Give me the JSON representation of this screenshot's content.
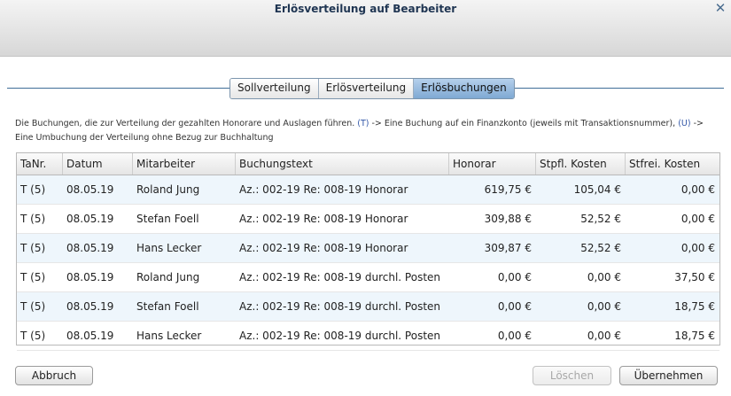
{
  "window": {
    "title": "Erlösverteilung auf Bearbeiter"
  },
  "tabs": [
    {
      "label": "Sollverteilung"
    },
    {
      "label": "Erlösverteilung"
    },
    {
      "label": "Erlösbuchungen"
    }
  ],
  "active_tab": "Erlösbuchungen",
  "description": {
    "part1": "Die Buchungen, die zur Verteilung der gezahlten Honorare und Auslagen führen. ",
    "mark1": "(T)",
    "part2": " -> Eine Buchung auf ein Finanzkonto (jeweils mit Transaktionsnummer), ",
    "mark2": "(U)",
    "part3": " -> Eine Umbuchung der Verteilung ohne Bezug zur Buchhaltung"
  },
  "table": {
    "columns": [
      "TaNr.",
      "Datum",
      "Mitarbeiter",
      "Buchungstext",
      "Honorar",
      "Stpfl. Kosten",
      "Stfrei. Kosten"
    ],
    "rows": [
      [
        "T (5)",
        "08.05.19",
        "Roland Jung",
        "Az.: 002-19 Re: 008-19  Honorar",
        "619,75 €",
        "105,04 €",
        "0,00 €"
      ],
      [
        "T (5)",
        "08.05.19",
        "Stefan Foell",
        "Az.: 002-19 Re: 008-19  Honorar",
        "309,88 €",
        "52,52 €",
        "0,00 €"
      ],
      [
        "T (5)",
        "08.05.19",
        "Hans Lecker",
        "Az.: 002-19 Re: 008-19  Honorar",
        "309,87 €",
        "52,52 €",
        "0,00 €"
      ],
      [
        "T (5)",
        "08.05.19",
        "Roland Jung",
        "Az.: 002-19 Re: 008-19  durchl. Posten",
        "0,00 €",
        "0,00 €",
        "37,50 €"
      ],
      [
        "T (5)",
        "08.05.19",
        "Stefan Foell",
        "Az.: 002-19 Re: 008-19  durchl. Posten",
        "0,00 €",
        "0,00 €",
        "18,75 €"
      ],
      [
        "T (5)",
        "08.05.19",
        "Hans Lecker",
        "Az.: 002-19 Re: 008-19  durchl. Posten",
        "0,00 €",
        "0,00 €",
        "18,75 €"
      ]
    ]
  },
  "buttons": {
    "cancel": "Abbruch",
    "delete": "Löschen",
    "apply": "Übernehmen"
  },
  "icons": {
    "close": "close-icon"
  },
  "colors": {
    "accent": "#3f6d97",
    "title_text": "#1f3552",
    "active_tab": "#8fb5dc",
    "row_alt": "#eef6fc"
  }
}
